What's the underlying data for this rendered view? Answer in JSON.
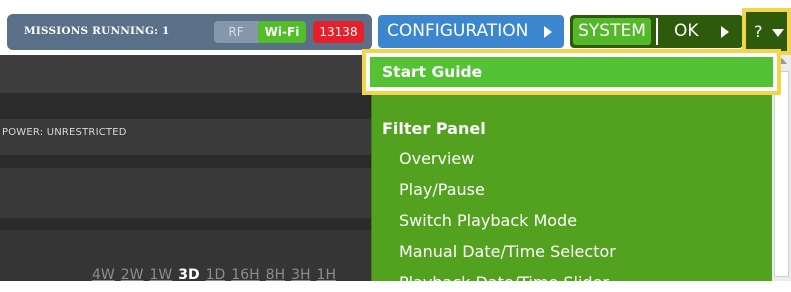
{
  "header": {
    "missions_label": "MISSIONS RUNNING: 1",
    "rf_label": "RF",
    "wifi_label": "Wi-Fi",
    "count_badge": "13138",
    "configuration_label": "CONFIGURATION",
    "system_label": "SYSTEM",
    "ok_label": "OK",
    "help_label": "?"
  },
  "panel": {
    "power_label": "POWER: UNRESTRICTED",
    "time_scale": [
      "4W",
      "2W",
      "1W",
      "3D",
      "1D",
      "16H",
      "8H",
      "3H",
      "1H"
    ],
    "time_scale_selected": "3D"
  },
  "help_menu": {
    "start_guide": "Start Guide",
    "section_heading": "Filter Panel",
    "items": [
      "Overview",
      "Play/Pause",
      "Switch Playback Mode",
      "Manual Date/Time Selector",
      "Playback Date/Time Slider"
    ]
  },
  "colors": {
    "accent_blue": "#3c86cf",
    "menu_green": "#53a21f",
    "highlight_yellow": "#f4d44a",
    "alert_red": "#e5202a"
  },
  "icons": {
    "config_arrow": "chevron-right-icon",
    "system_arrow": "chevron-right-icon",
    "help_caret": "caret-down-icon",
    "scroll_up": "arrow-up-icon"
  }
}
